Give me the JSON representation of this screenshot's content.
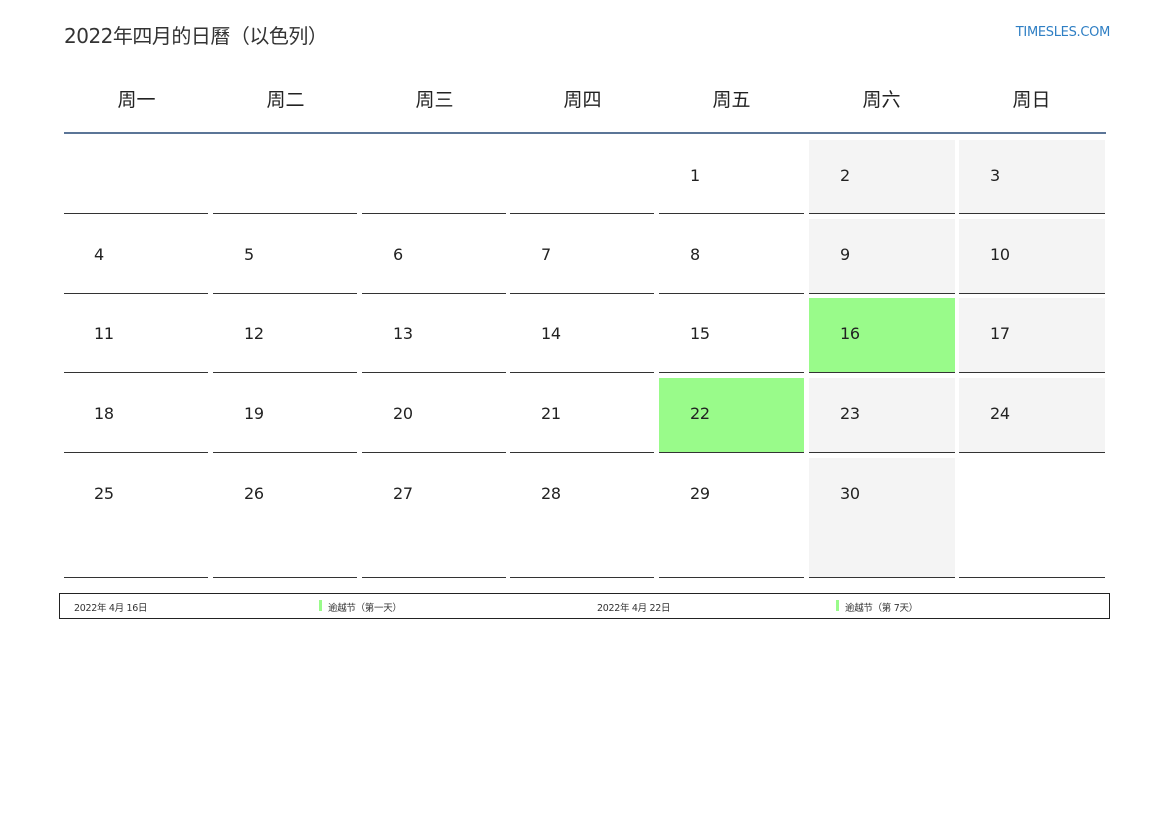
{
  "title": "2022年四月的日曆（以色列）",
  "site": "TIMESLES.COM",
  "colors": {
    "holiday": "#99fb8a",
    "weekend": "#f4f4f4",
    "header_rule": "#5b7597",
    "link": "#2f7fc4"
  },
  "weekdays": [
    "周一",
    "周二",
    "周三",
    "周四",
    "周五",
    "周六",
    "周日"
  ],
  "weeks": [
    [
      "",
      "",
      "",
      "",
      "1",
      "2",
      "3"
    ],
    [
      "4",
      "5",
      "6",
      "7",
      "8",
      "9",
      "10"
    ],
    [
      "11",
      "12",
      "13",
      "14",
      "15",
      "16",
      "17"
    ],
    [
      "18",
      "19",
      "20",
      "21",
      "22",
      "23",
      "24"
    ],
    [
      "25",
      "26",
      "27",
      "28",
      "29",
      "30",
      ""
    ]
  ],
  "holidays": [
    {
      "date": "2022年 4月 16日",
      "name": "逾越节（第一天）"
    },
    {
      "date": "2022年 4月 22日",
      "name": "逾越节（第 7天）"
    }
  ]
}
